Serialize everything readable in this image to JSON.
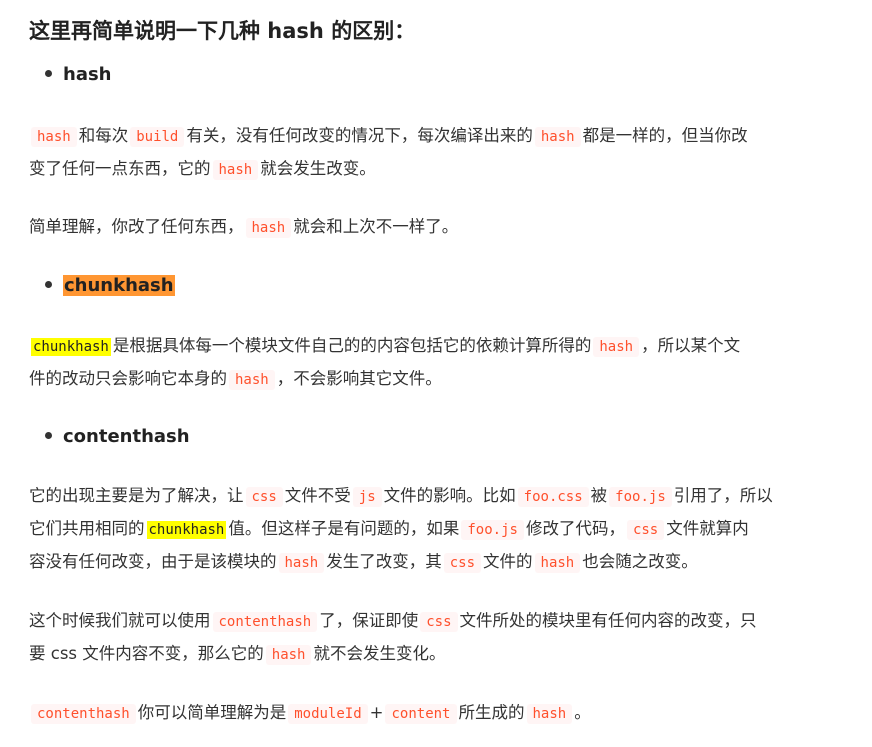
{
  "heading": "这里再简单说明一下几种 hash 的区别：",
  "sections": [
    {
      "bullet": "hash",
      "paragraphs": [
        [
          {
            "t": "code",
            "v": "hash"
          },
          {
            "t": "text",
            "v": "和每次"
          },
          {
            "t": "code",
            "v": "build"
          },
          {
            "t": "text",
            "v": "有关，没有任何改变的情况下，每次编译出来的"
          },
          {
            "t": "code",
            "v": "hash"
          },
          {
            "t": "text",
            "v": "都是一样的，但当你改"
          },
          {
            "t": "br"
          },
          {
            "t": "text",
            "v": "变了任何一点东西，它的"
          },
          {
            "t": "code",
            "v": "hash"
          },
          {
            "t": "text",
            "v": "就会发生改变。"
          }
        ],
        [
          {
            "t": "text",
            "v": "简单理解，你改了任何东西，"
          },
          {
            "t": "code",
            "v": "hash"
          },
          {
            "t": "text",
            "v": "就会和上次不一样了。"
          }
        ]
      ]
    },
    {
      "bullet": "chunkhash",
      "paragraphs": [
        [
          {
            "t": "hl",
            "v": "chunkhash"
          },
          {
            "t": "text",
            "v": "是根据具体每一个模块文件自己的的内容包括它的依赖计算所得的"
          },
          {
            "t": "code",
            "v": "hash"
          },
          {
            "t": "text",
            "v": "，所以某个文"
          },
          {
            "t": "br"
          },
          {
            "t": "text",
            "v": "件的改动只会影响它本身的"
          },
          {
            "t": "code",
            "v": "hash"
          },
          {
            "t": "text",
            "v": "，不会影响其它文件。"
          }
        ]
      ]
    },
    {
      "bullet": "contenthash",
      "paragraphs": [
        [
          {
            "t": "text",
            "v": "它的出现主要是为了解决，让"
          },
          {
            "t": "code",
            "v": "css"
          },
          {
            "t": "text",
            "v": "文件不受"
          },
          {
            "t": "code",
            "v": "js"
          },
          {
            "t": "text",
            "v": "文件的影响。比如"
          },
          {
            "t": "code",
            "v": "foo.css"
          },
          {
            "t": "text",
            "v": "被"
          },
          {
            "t": "code",
            "v": "foo.js"
          },
          {
            "t": "text",
            "v": "引用了，所以"
          },
          {
            "t": "br"
          },
          {
            "t": "text",
            "v": "它们共用相同的"
          },
          {
            "t": "hl",
            "v": "chunkhash"
          },
          {
            "t": "text",
            "v": "值。但这样子是有问题的，如果"
          },
          {
            "t": "code",
            "v": "foo.js"
          },
          {
            "t": "text",
            "v": "修改了代码，"
          },
          {
            "t": "code",
            "v": "css"
          },
          {
            "t": "text",
            "v": "文件就算内"
          },
          {
            "t": "br"
          },
          {
            "t": "text",
            "v": "容没有任何改变，由于是该模块的"
          },
          {
            "t": "code",
            "v": "hash"
          },
          {
            "t": "text",
            "v": "发生了改变，其"
          },
          {
            "t": "code",
            "v": "css"
          },
          {
            "t": "text",
            "v": "文件的"
          },
          {
            "t": "code",
            "v": "hash"
          },
          {
            "t": "text",
            "v": "也会随之改变。"
          }
        ],
        [
          {
            "t": "text",
            "v": "这个时候我们就可以使用"
          },
          {
            "t": "code",
            "v": "contenthash"
          },
          {
            "t": "text",
            "v": "了，保证即使"
          },
          {
            "t": "code",
            "v": "css"
          },
          {
            "t": "text",
            "v": "文件所处的模块里有任何内容的改变，只"
          },
          {
            "t": "br"
          },
          {
            "t": "text",
            "v": "要 css 文件内容不变，那么它的"
          },
          {
            "t": "code",
            "v": "hash"
          },
          {
            "t": "text",
            "v": "就不会发生变化。"
          }
        ],
        [
          {
            "t": "code",
            "v": "contenthash"
          },
          {
            "t": "text",
            "v": "你可以简单理解为是"
          },
          {
            "t": "code",
            "v": "moduleId"
          },
          {
            "t": "text",
            "v": "+"
          },
          {
            "t": "code",
            "v": "content"
          },
          {
            "t": "text",
            "v": "所生成的"
          },
          {
            "t": "code",
            "v": "hash"
          },
          {
            "t": "text",
            "v": "。"
          }
        ]
      ]
    }
  ]
}
